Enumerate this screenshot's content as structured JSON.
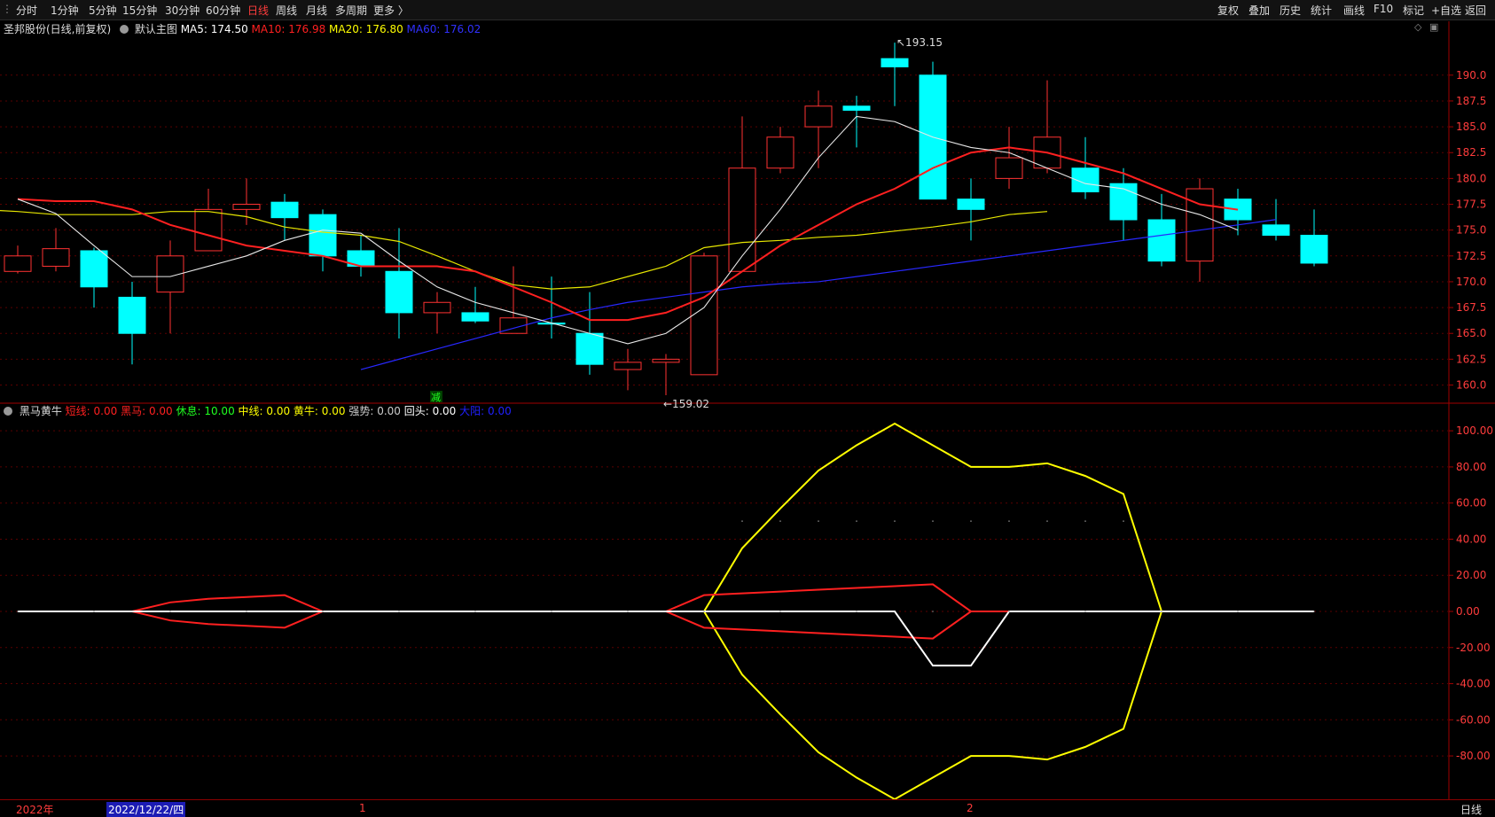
{
  "toolbar": {
    "left_items": [
      "分时",
      "1分钟",
      "5分钟",
      "15分钟",
      "30分钟",
      "60分钟",
      "日线",
      "周线",
      "月线",
      "多周期",
      "更多"
    ],
    "active": "日线",
    "right_items": [
      "复权",
      "叠加",
      "历史",
      "统计",
      "画线",
      "F10",
      "标记",
      "+自选",
      "返回"
    ]
  },
  "main": {
    "stock_title": "圣邦股份(日线,前复权)",
    "template_label": "默认主图",
    "ma": [
      {
        "label": "MA5: 174.50",
        "color": "#ffffff"
      },
      {
        "label": "MA10: 176.98",
        "color": "#ff2020"
      },
      {
        "label": "MA20: 176.80",
        "color": "#ffff00"
      },
      {
        "label": "MA60: 176.02",
        "color": "#3030ff"
      }
    ],
    "high_label": "193.15",
    "low_label": "←159.02",
    "marker_label": "减"
  },
  "indicator": {
    "name": "黑马黄牛",
    "params": [
      {
        "label": "短线:",
        "value": "0.00",
        "color": "#ff2020",
        "vcolor": "#ff2020"
      },
      {
        "label": "黑马:",
        "value": "0.00",
        "color": "#ff2020",
        "vcolor": "#ff2020"
      },
      {
        "label": "休息:",
        "value": "10.00",
        "color": "#20ff20",
        "vcolor": "#20ff20"
      },
      {
        "label": "中线:",
        "value": "0.00",
        "color": "#ffff00",
        "vcolor": "#ffff00"
      },
      {
        "label": "黄牛:",
        "value": "0.00",
        "color": "#ffff00",
        "vcolor": "#ffff00"
      },
      {
        "label": "强势:",
        "value": "0.00",
        "color": "#cccccc",
        "vcolor": "#cccccc"
      },
      {
        "label": "回头:",
        "value": "0.00",
        "color": "#ffffff",
        "vcolor": "#ffffff"
      },
      {
        "label": "大阳:",
        "value": "0.00",
        "color": "#2020ff",
        "vcolor": "#2020ff"
      }
    ]
  },
  "bottom": {
    "year": "2022年",
    "cursor_date": "2022/12/22/四",
    "month1": "1",
    "month2": "2",
    "period": "日线"
  },
  "chart_data": [
    {
      "type": "candlestick",
      "ylim": [
        158.5,
        193.5
      ],
      "y_ticks": [
        "190.0",
        "187.5",
        "185.0",
        "182.5",
        "180.0",
        "177.5",
        "175.0",
        "172.5",
        "170.0",
        "167.5",
        "165.0",
        "162.5",
        "160.0"
      ],
      "candles": [
        {
          "o": 171.0,
          "h": 173.5,
          "l": 170.8,
          "c": 172.5
        },
        {
          "o": 171.5,
          "h": 175.2,
          "l": 171.0,
          "c": 173.2
        },
        {
          "o": 173.0,
          "h": 173.3,
          "l": 167.5,
          "c": 169.5
        },
        {
          "o": 168.5,
          "h": 170.0,
          "l": 162.0,
          "c": 165.0
        },
        {
          "o": 169.0,
          "h": 174.0,
          "l": 165.0,
          "c": 172.5
        },
        {
          "o": 173.0,
          "h": 179.0,
          "l": 173.0,
          "c": 177.0
        },
        {
          "o": 177.0,
          "h": 180.0,
          "l": 175.5,
          "c": 177.5
        },
        {
          "o": 177.7,
          "h": 178.5,
          "l": 174.0,
          "c": 176.2
        },
        {
          "o": 176.5,
          "h": 177.0,
          "l": 171.0,
          "c": 172.5
        },
        {
          "o": 173.0,
          "h": 174.5,
          "l": 170.5,
          "c": 171.5
        },
        {
          "o": 171.0,
          "h": 175.2,
          "l": 164.5,
          "c": 167.0
        },
        {
          "o": 167.0,
          "h": 169.0,
          "l": 165.0,
          "c": 168.0
        },
        {
          "o": 167.0,
          "h": 169.5,
          "l": 166.0,
          "c": 166.2
        },
        {
          "o": 165.0,
          "h": 171.5,
          "l": 165.0,
          "c": 166.5
        },
        {
          "o": 166.0,
          "h": 170.5,
          "l": 164.5,
          "c": 165.9
        },
        {
          "o": 165.0,
          "h": 169.0,
          "l": 161.0,
          "c": 162.0
        },
        {
          "o": 161.5,
          "h": 163.5,
          "l": 159.5,
          "c": 162.2
        },
        {
          "o": 162.2,
          "h": 163.0,
          "l": 159.02,
          "c": 162.5
        },
        {
          "o": 161.0,
          "h": 172.8,
          "l": 161.0,
          "c": 172.5
        },
        {
          "o": 171.0,
          "h": 186.0,
          "l": 171.0,
          "c": 181.0
        },
        {
          "o": 181.0,
          "h": 185.0,
          "l": 180.5,
          "c": 184.0
        },
        {
          "o": 185.0,
          "h": 188.5,
          "l": 181.0,
          "c": 187.0
        },
        {
          "o": 187.0,
          "h": 188.0,
          "l": 183.0,
          "c": 186.6
        },
        {
          "o": 191.6,
          "h": 193.15,
          "l": 187.0,
          "c": 190.8
        },
        {
          "o": 190.0,
          "h": 191.3,
          "l": 178.0,
          "c": 178.0
        },
        {
          "o": 178.0,
          "h": 180.0,
          "l": 174.0,
          "c": 177.0
        },
        {
          "o": 180.0,
          "h": 185.0,
          "l": 179.0,
          "c": 182.0
        },
        {
          "o": 181.0,
          "h": 189.5,
          "l": 180.5,
          "c": 184.0
        },
        {
          "o": 181.0,
          "h": 184.0,
          "l": 178.0,
          "c": 178.7
        },
        {
          "o": 179.5,
          "h": 181.0,
          "l": 174.0,
          "c": 176.0
        },
        {
          "o": 176.0,
          "h": 178.5,
          "l": 171.5,
          "c": 172.0
        },
        {
          "o": 172.0,
          "h": 180.0,
          "l": 170.0,
          "c": 179.0
        },
        {
          "o": 178.0,
          "h": 179.0,
          "l": 174.5,
          "c": 176.0
        },
        {
          "o": 175.5,
          "h": 178.0,
          "l": 174.0,
          "c": 174.5
        },
        {
          "o": 174.5,
          "h": 177.0,
          "l": 171.5,
          "c": 171.8
        }
      ],
      "ma5": [
        178.0,
        176.6,
        173.5,
        170.5,
        170.5,
        171.5,
        172.5,
        174.0,
        175.0,
        174.7,
        172.0,
        169.5,
        168.0,
        167.0,
        166.0,
        165.0,
        164.0,
        165.0,
        167.5,
        172.5,
        177.0,
        182.0,
        186.0,
        185.5,
        184.0,
        183.0,
        182.5,
        181.0,
        179.5,
        179.0,
        177.5,
        176.5,
        175.0
      ],
      "ma10": [
        178.0,
        177.8,
        177.8,
        177.0,
        175.5,
        174.5,
        173.5,
        173.0,
        172.5,
        171.5,
        171.5,
        171.5,
        171.0,
        169.5,
        168.0,
        166.3,
        166.3,
        167.0,
        168.5,
        171.0,
        173.5,
        175.5,
        177.5,
        179.0,
        181.0,
        182.5,
        183.0,
        182.5,
        181.5,
        180.5,
        179.0,
        177.5,
        176.98
      ],
      "ma20": [
        177.0,
        176.8,
        176.5,
        176.5,
        176.5,
        176.8,
        176.8,
        176.3,
        175.3,
        174.8,
        174.5,
        173.9,
        172.5,
        171.0,
        169.7,
        169.3,
        169.5,
        170.5,
        171.5,
        173.3,
        173.8,
        174.0,
        174.3,
        174.5,
        174.9,
        175.3,
        175.8,
        176.5,
        176.8
      ],
      "ma60": [
        161.5,
        162.5,
        163.5,
        164.5,
        165.5,
        166.5,
        167.3,
        168.0,
        168.5,
        169.0,
        169.5,
        169.8,
        170.0,
        170.5,
        171.0,
        171.5,
        172.0,
        172.5,
        173.0,
        173.5,
        174.0,
        174.5,
        175.0,
        175.5,
        176.02
      ]
    },
    {
      "type": "line",
      "ylim": [
        -104,
        104
      ],
      "y_ticks": [
        "100.00",
        "80.00",
        "60.00",
        "40.00",
        "20.00",
        "0.00",
        "-20.00",
        "-40.00",
        "-60.00",
        "-80.00"
      ],
      "series": [
        {
          "name": "中线",
          "color": "#ffff00",
          "values": [
            0,
            0,
            0,
            0,
            0,
            0,
            0,
            0,
            0,
            0,
            0,
            0,
            0,
            0,
            0,
            0,
            0,
            0,
            0,
            35,
            57,
            78,
            92,
            104,
            92,
            80,
            80,
            82,
            75,
            65,
            0,
            0,
            0,
            0,
            0
          ]
        },
        {
          "name": "短线",
          "color": "#ff2020",
          "values": [
            0,
            0,
            0,
            0,
            5,
            7,
            8,
            9,
            0,
            0,
            0,
            0,
            0,
            0,
            0,
            0,
            0,
            0,
            9,
            10,
            11,
            12,
            13,
            14,
            15,
            0,
            0,
            0,
            0,
            0,
            0,
            0,
            0,
            0,
            0
          ]
        },
        {
          "name": "回头",
          "color": "#ffffff",
          "values": [
            0,
            0,
            0,
            0,
            0,
            0,
            0,
            0,
            0,
            0,
            0,
            0,
            0,
            0,
            0,
            0,
            0,
            0,
            0,
            0,
            0,
            0,
            0,
            0,
            -30,
            -30,
            0,
            0,
            0,
            0,
            0,
            0,
            0,
            0,
            0
          ]
        }
      ]
    }
  ]
}
